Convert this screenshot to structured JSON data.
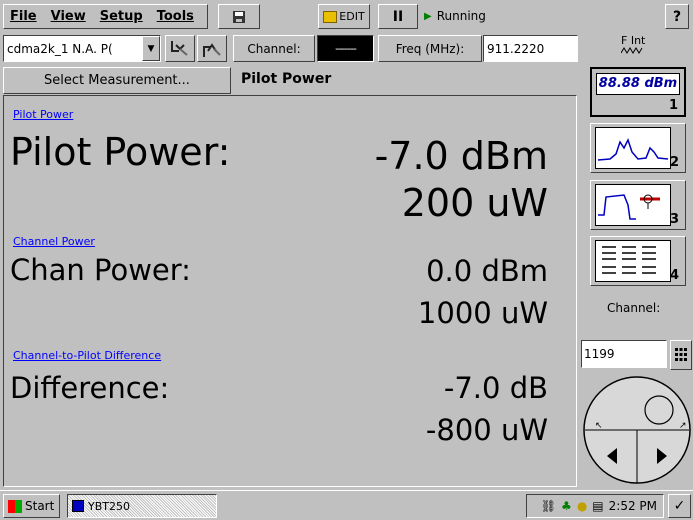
{
  "menu": {
    "file": "File",
    "view": "View",
    "setup": "Setup",
    "tools": "Tools"
  },
  "toolbar": {
    "save_icon": "save-icon",
    "edit_label": "EDIT",
    "pause_symbol": "II",
    "status": "Running",
    "help_label": "?"
  },
  "row2": {
    "standard_value": "cdma2k_1 N.A. P(",
    "channel_button": "Channel:",
    "channel_value": "-------",
    "freq_button": "Freq (MHz):",
    "freq_value": "911.2220",
    "fint_label": "F Int"
  },
  "measurement": {
    "select_button": "Select Measurement...",
    "title": "Pilot Power"
  },
  "sections": [
    {
      "link": "Pilot Power",
      "label": "Pilot Power:",
      "value1": "-7.0 dBm",
      "value2": "200 uW"
    },
    {
      "link": "Channel Power",
      "label": "Chan Power:",
      "value1": "0.0 dBm",
      "value2": "1000 uW"
    },
    {
      "link": "Channel-to-Pilot Difference",
      "label": "Difference:",
      "value1": "-7.0 dB",
      "value2": "-800 uW"
    }
  ],
  "side": {
    "btn1_text": "88.88 dBm",
    "btn1_num": "1",
    "btn2_num": "2",
    "btn3_num": "3",
    "btn4_num": "4",
    "channel_label": "Channel:",
    "channel_value": "1199"
  },
  "taskbar": {
    "start": "Start",
    "task": "YBT250",
    "clock": "2:52 PM"
  },
  "colors": {
    "background": "#c0c0c0",
    "link": "#0000ff",
    "status_green": "#008000"
  }
}
